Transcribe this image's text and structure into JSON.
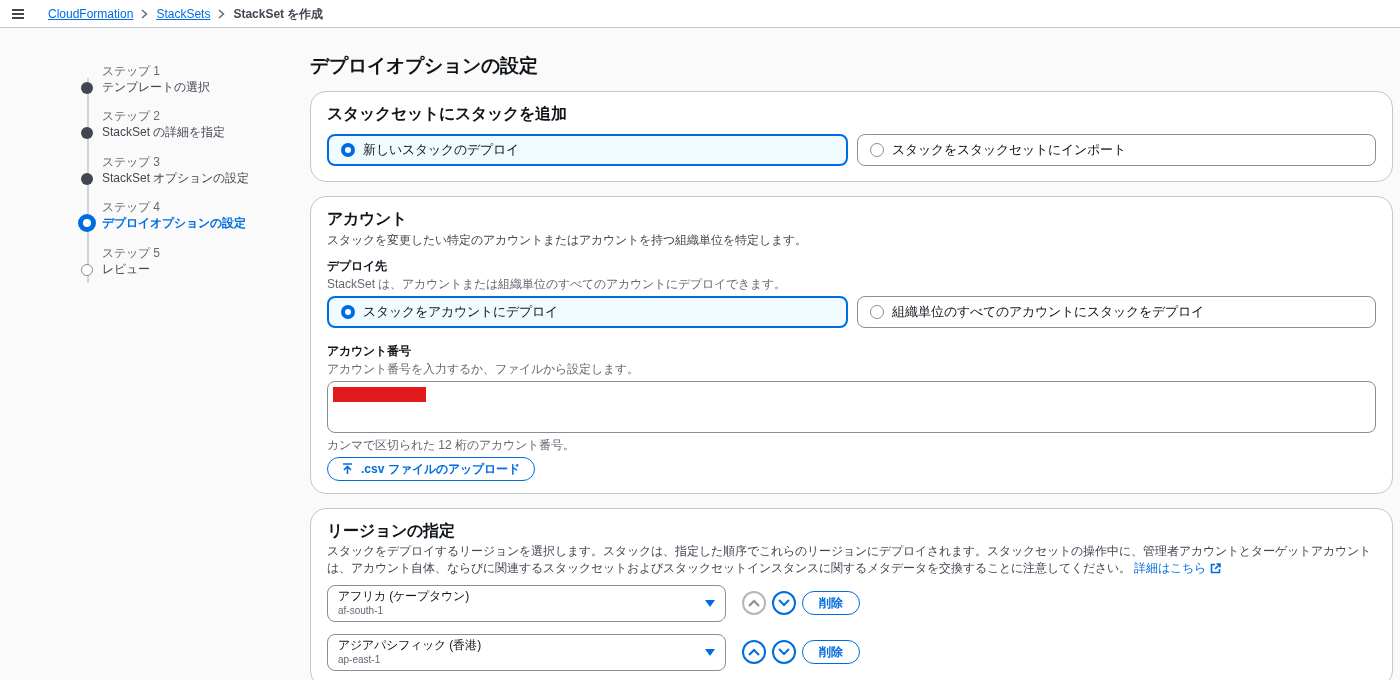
{
  "breadcrumb": [
    {
      "label": "CloudFormation",
      "link": true
    },
    {
      "label": "StackSets",
      "link": true
    },
    {
      "label": "StackSet を作成",
      "link": false
    }
  ],
  "steps": [
    {
      "step": "ステップ 1",
      "label": "テンプレートの選択",
      "completed": true,
      "selected": false
    },
    {
      "step": "ステップ 2",
      "label": "StackSet の詳細を指定",
      "completed": true,
      "selected": false
    },
    {
      "step": "ステップ 3",
      "label": "StackSet オプションの設定",
      "completed": true,
      "selected": false
    },
    {
      "step": "ステップ 4",
      "label": "デプロイオプションの設定",
      "selected": true
    },
    {
      "step": "ステップ 5",
      "label": "レビュー",
      "completed": false,
      "selected": false
    }
  ],
  "page_title": "デプロイオプションの設定",
  "add_stacks": {
    "title": "スタックセットにスタックを追加",
    "options": [
      {
        "label": "新しいスタックのデプロイ",
        "selected": true
      },
      {
        "label": "スタックをスタックセットにインポート",
        "selected": false
      }
    ]
  },
  "accounts": {
    "title": "アカウント",
    "description": "スタックを変更したい特定のアカウントまたはアカウントを持つ組織単位を特定します。",
    "deploy_target": {
      "label": "デプロイ先",
      "description": "StackSet は、アカウントまたは組織単位のすべてのアカウントにデプロイできます。",
      "options": [
        {
          "label": "スタックをアカウントにデプロイ",
          "selected": true
        },
        {
          "label": "組織単位のすべてのアカウントにスタックをデプロイ",
          "selected": false
        }
      ]
    },
    "account_numbers": {
      "label": "アカウント番号",
      "description": "アカウント番号を入力するか、ファイルから設定します。",
      "redacted": true,
      "hint": "カンマで区切られた 12 桁のアカウント番号。",
      "upload_button": ".csv ファイルのアップロード"
    }
  },
  "regions": {
    "title": "リージョンの指定",
    "description": "スタックをデプロイするリージョンを選択します。スタックは、指定した順序でこれらのリージョンにデプロイされます。スタックセットの操作中に、管理者アカウントとターゲットアカウントは、アカウント自体、ならびに関連するスタックセットおよびスタックセットインスタンスに関するメタデータを交換することに注意してください。",
    "link": "詳細はこちら",
    "rows": [
      {
        "name": "アフリカ (ケープタウン)",
        "code": "af-south-1",
        "up_disabled": true,
        "down_disabled": false,
        "remove": "削除"
      },
      {
        "name": "アジアパシフィック (香港)",
        "code": "ap-east-1",
        "up_disabled": false,
        "down_disabled": false,
        "remove": "削除"
      }
    ]
  }
}
